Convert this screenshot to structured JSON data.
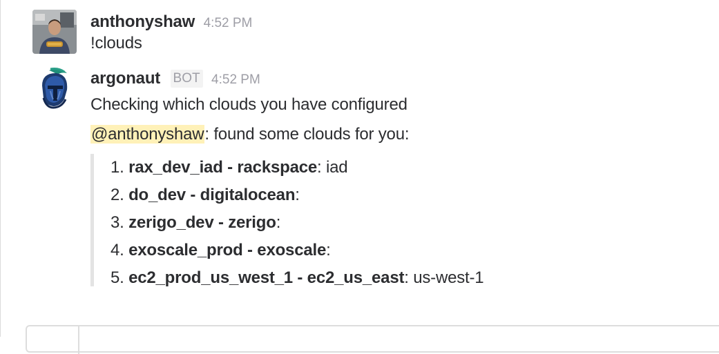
{
  "messages": [
    {
      "sender": "anthonyshaw",
      "timestamp": "4:52 PM",
      "avatar_icon": "user-photo-avatar",
      "text": "!clouds"
    },
    {
      "sender": "argonaut",
      "badge": "BOT",
      "timestamp": "4:52 PM",
      "avatar_icon": "spartan-helmet-avatar",
      "text": "Checking which clouds you have configured",
      "mention": "@anthonyshaw",
      "mention_suffix": ": found some clouds for you:",
      "clouds": [
        {
          "number": "1.",
          "name": "rax_dev_iad - rackspace",
          "detail": ": iad"
        },
        {
          "number": "2.",
          "name": "do_dev - digitalocean",
          "detail": ":"
        },
        {
          "number": "3.",
          "name": "zerigo_dev - zerigo",
          "detail": ":"
        },
        {
          "number": "4.",
          "name": "exoscale_prod - exoscale",
          "detail": ":"
        },
        {
          "number": "5.",
          "name": "ec2_prod_us_west_1 - ec2_us_east",
          "detail": ": us-west-1"
        }
      ]
    }
  ],
  "colors": {
    "mention_highlight": "#fff1b8",
    "attachment_bar": "#e3e3e3",
    "timestamp": "#9e9ea6"
  }
}
